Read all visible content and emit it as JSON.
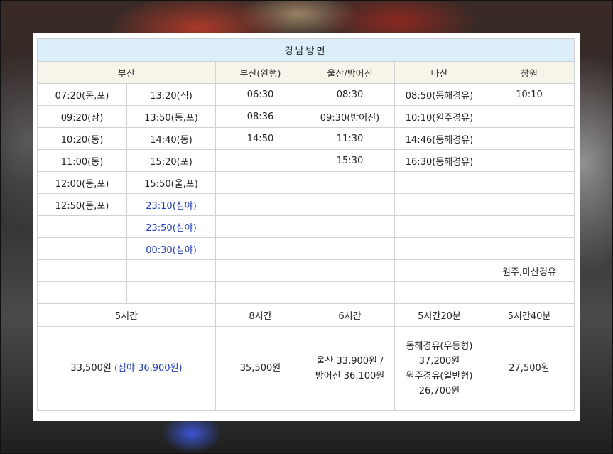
{
  "title": "경남방면",
  "headers": [
    "부산",
    "부산(완행)",
    "울산/방어진",
    "마산",
    "창원"
  ],
  "rows": [
    {
      "b1": "07:20(동,포)",
      "b2": "13:20(직)",
      "wanhaeng": "06:30",
      "ulsan": "08:30",
      "masan": "08:50(동해경유)",
      "changwon": "10:10"
    },
    {
      "b1": "09:20(삼)",
      "b2": "13:50(동,포)",
      "wanhaeng": "08:36",
      "ulsan": "09:30(방어진)",
      "masan": "10:10(원주경유)",
      "changwon": ""
    },
    {
      "b1": "10:20(동)",
      "b2": "14:40(동)",
      "wanhaeng": "14:50",
      "ulsan": "11:30",
      "masan": "14:46(동해경유)",
      "changwon": ""
    },
    {
      "b1": "11:00(동)",
      "b2": "15:20(포)",
      "wanhaeng": "",
      "ulsan": "15:30",
      "masan": "16:30(동해경유)",
      "changwon": ""
    },
    {
      "b1": "12:00(동,포)",
      "b2": "15:50(울,포)",
      "wanhaeng": "",
      "ulsan": "",
      "masan": "",
      "changwon": ""
    },
    {
      "b1": "12:50(동,포)",
      "b2": "23:10(심야)",
      "wanhaeng": "",
      "ulsan": "",
      "masan": "",
      "changwon": ""
    },
    {
      "b1": "",
      "b2": "23:50(심야)",
      "wanhaeng": "",
      "ulsan": "",
      "masan": "",
      "changwon": ""
    },
    {
      "b1": "",
      "b2": "00:30(심야)",
      "wanhaeng": "",
      "ulsan": "",
      "masan": "",
      "changwon": ""
    },
    {
      "b1": "",
      "b2": "",
      "wanhaeng": "",
      "ulsan": "",
      "masan": "",
      "changwon": "원주,마산경유"
    },
    {
      "b1": "",
      "b2": "",
      "wanhaeng": "",
      "ulsan": "",
      "masan": "",
      "changwon": ""
    }
  ],
  "durations": {
    "busan": "5시간",
    "wanhaeng": "8시간",
    "ulsan": "6시간",
    "masan": "5시간20분",
    "changwon": "5시간40분"
  },
  "fares": {
    "busan": "33,500원",
    "busan_night": "(심야 36,900원)",
    "wanhaeng": "35,500원",
    "ulsan_1": "울산 33,900원 /",
    "ulsan_2": "방어진 36,100원",
    "masan_1": "동해경유(우등형)",
    "masan_2": "37,200원",
    "masan_3": "원주경유(일반형)",
    "masan_4": "26,700원",
    "changwon": "27,500원"
  },
  "colors": {
    "title_bg": "#dbeef9",
    "header_bg": "#f7f4ea",
    "night_text": "#2340b8",
    "border": "#cfd3d8"
  }
}
